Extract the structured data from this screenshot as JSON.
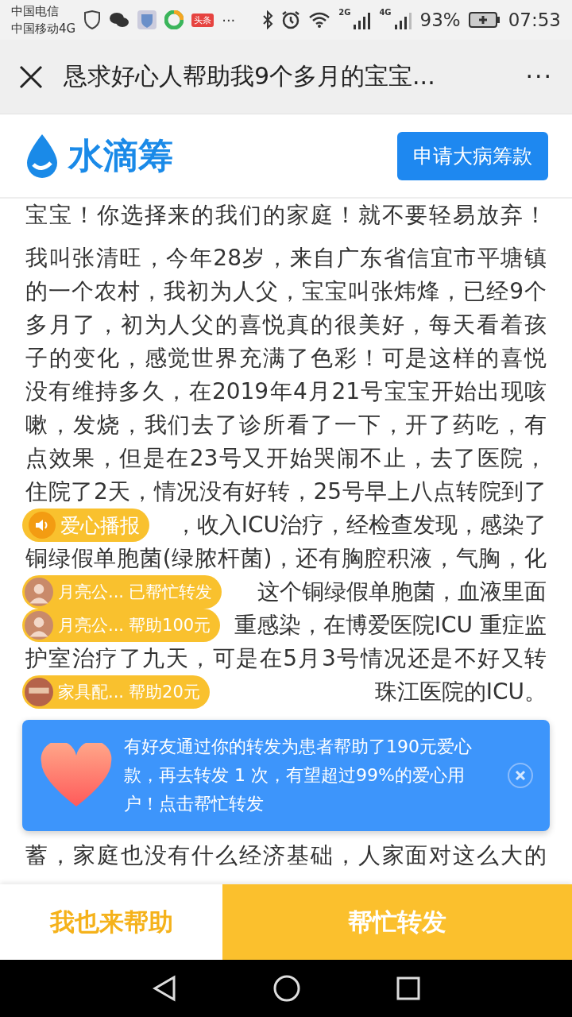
{
  "status_bar": {
    "carriers": [
      "中国电信",
      "中国移动4G"
    ],
    "app_badge": "头条",
    "more": "···",
    "network_1": "2G",
    "network_2": "4G",
    "battery": "93%",
    "time": "07:53"
  },
  "title_bar": {
    "title": "恳求好心人帮助我9个多月的宝宝...",
    "menu": "···"
  },
  "app_header": {
    "brand": "水滴筹",
    "button": "申请大病筹款"
  },
  "article": {
    "cut_line": "宝宝！你选择来的我们的家庭！就不要轻易放弃！",
    "lines": [
      {
        "text": "我叫张清旺，今年28岁，来自广东省信宜市平塘镇"
      },
      {
        "text": "的一个农村，我初为人父，宝宝叫张炜烽，已经9个"
      },
      {
        "text": "多月了，初为人父的喜悦真的很美好，每天看着孩"
      },
      {
        "text": "子的变化，感觉世界充满了色彩！可是这样的喜悦"
      },
      {
        "text": "没有维持多久，在2019年4月21号宝宝开始出现咳"
      },
      {
        "text": "嗽，发烧，我们去了诊所看了一下，开了药吃，有"
      },
      {
        "text": "点效果，但是在23号又开始哭闹不止，去了医院，"
      },
      {
        "text": "住院了2天，情况没有好转，25号早上八点转院到了"
      },
      {
        "text": "，收入ICU治疗，经检查发现，感染了",
        "bubble": {
          "kind": "broadcast",
          "label": "爱心播报"
        }
      },
      {
        "text": "铜绿假单胞菌(绿脓杆菌)，还有胸腔积液，气胸，化"
      },
      {
        "text": "这个铜绿假单胞菌，血液里面",
        "bubble": {
          "kind": "donor",
          "name": "月亮公...",
          "action": "已帮忙转发"
        }
      },
      {
        "text": "重感染，在博爱医院ICU 重症监",
        "bubble": {
          "kind": "donor",
          "name": "月亮公...",
          "action": "帮助100元"
        }
      },
      {
        "text": "护室治疗了九天，可是在5月3号情况还是不好又转"
      },
      {
        "text": "珠江医院的ICU。",
        "bubble": {
          "kind": "shop",
          "name": "家具配...",
          "action": "帮助20元"
        }
      }
    ],
    "after_line": "蓄，家庭也没有什么经济基础，人家面对这么大的"
  },
  "banner": {
    "text": "有好友通过你的转发为患者帮助了190元爱心款，再去转发 1 次，有望超过99%的爱心用户！点击帮忙转发"
  },
  "bottom_bar": {
    "help": "我也来帮助",
    "share": "帮忙转发"
  }
}
